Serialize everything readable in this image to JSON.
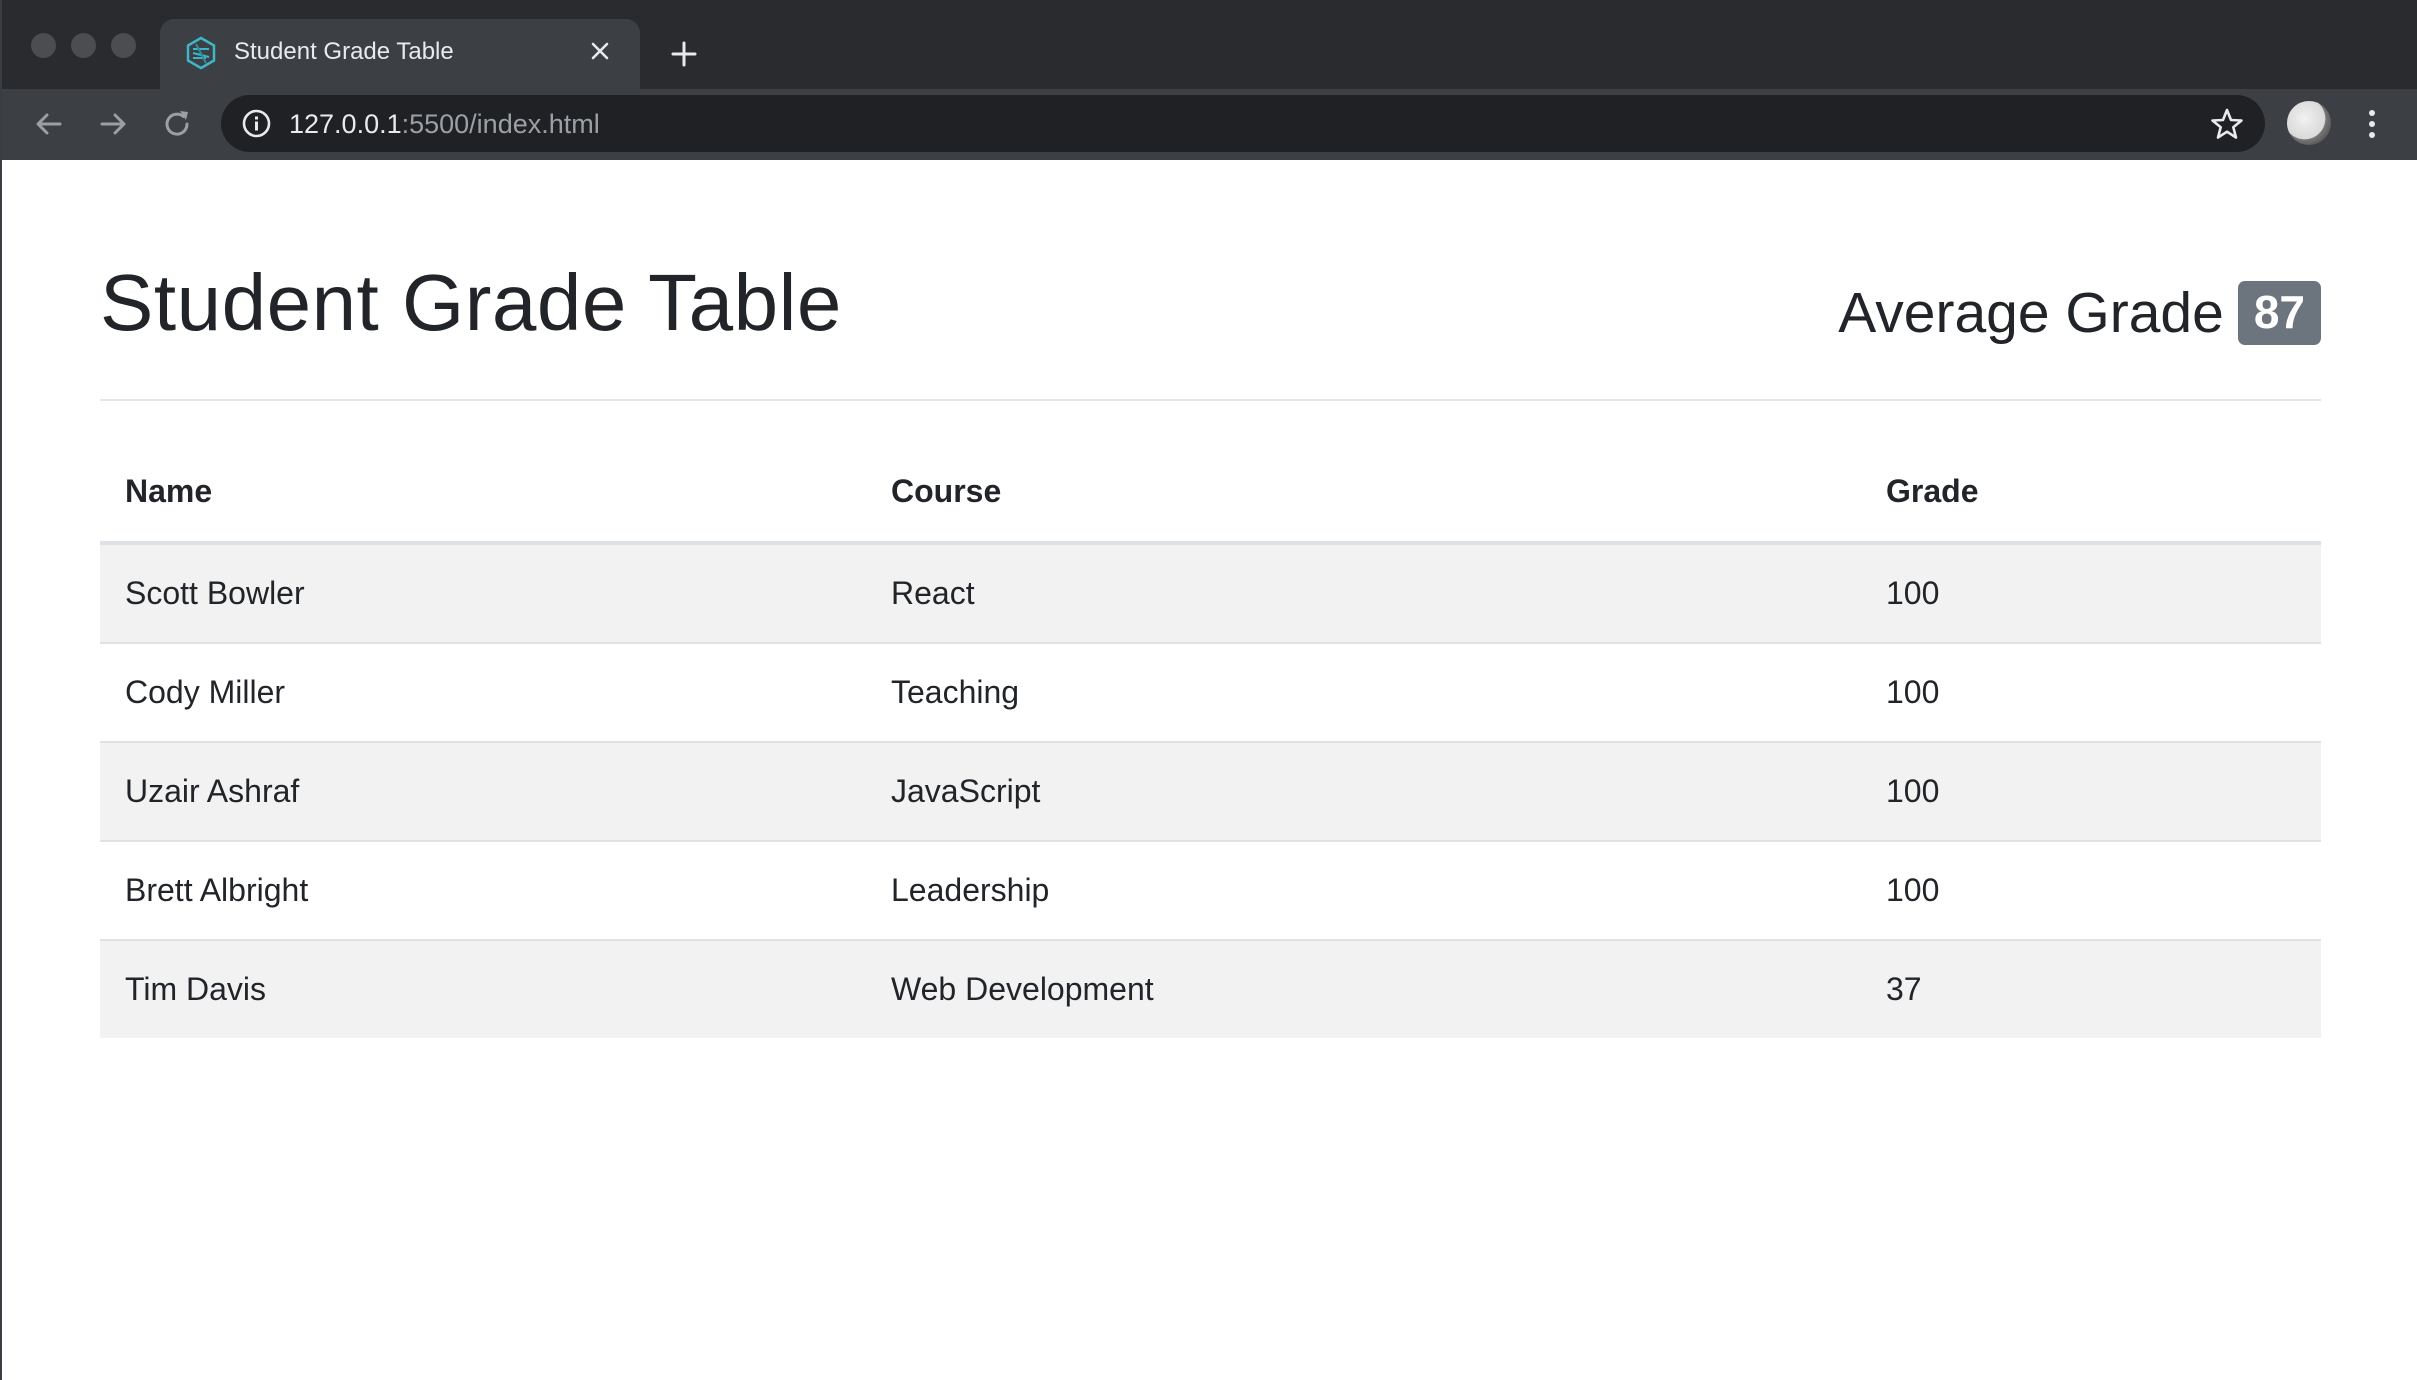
{
  "browser": {
    "tab_title": "Student Grade Table",
    "url_host": "127.0.0.1",
    "url_rest": ":5500/index.html",
    "icons": {
      "favicon": "app-logo-icon",
      "close": "close-icon",
      "new_tab": "plus-icon",
      "back": "arrow-left-icon",
      "forward": "arrow-right-icon",
      "reload": "reload-icon",
      "site_info": "info-icon",
      "bookmark": "star-icon",
      "menu": "vertical-dots-icon"
    }
  },
  "page": {
    "title": "Student Grade Table",
    "average_label": "Average Grade",
    "average_value": "87",
    "colors": {
      "text": "#212529",
      "badge": "#6c757d",
      "stripe": "#f2f2f2"
    }
  },
  "table": {
    "headers": [
      "Name",
      "Course",
      "Grade"
    ],
    "rows": [
      {
        "name": "Scott Bowler",
        "course": "React",
        "grade": "100"
      },
      {
        "name": "Cody Miller",
        "course": "Teaching",
        "grade": "100"
      },
      {
        "name": "Uzair Ashraf",
        "course": "JavaScript",
        "grade": "100"
      },
      {
        "name": "Brett Albright",
        "course": "Leadership",
        "grade": "100"
      },
      {
        "name": "Tim Davis",
        "course": "Web Development",
        "grade": "37"
      }
    ]
  }
}
